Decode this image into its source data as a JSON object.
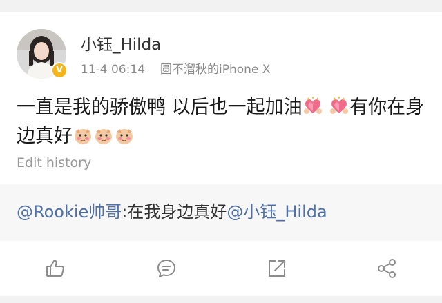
{
  "post": {
    "username": "小钰_Hilda",
    "timestamp": "11-4 06:14",
    "source": "圆不溜秋的iPhone X",
    "text_part1": "一直是我的骄傲鸭 以后也一起加油",
    "text_part2": "有你在身边真好",
    "edit_history_label": "Edit history"
  },
  "repost": {
    "mention1": "@Rookie帅哥",
    "text": ":在我身边真好",
    "mention2": "@小钰_Hilda"
  },
  "icons": {
    "verified": "verified-badge-icon",
    "heart_emoji": "heart-hands-emoji",
    "shy_emoji": "shy-face-emoji",
    "like": "thumbs-up-icon",
    "comment": "comment-icon",
    "share": "share-external-icon",
    "more": "share-nodes-icon"
  },
  "colors": {
    "mention": "#4f71a8",
    "verified": "#f6b618",
    "icon_gray": "#9a9a9a"
  }
}
